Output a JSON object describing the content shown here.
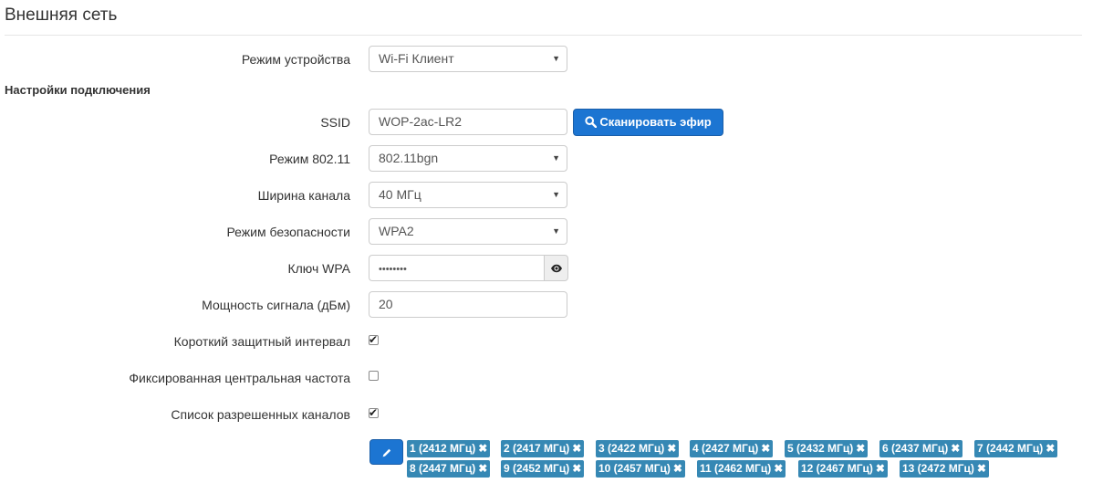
{
  "page": {
    "title": "Внешняя сеть",
    "section_title": "Настройки подключения"
  },
  "fields": {
    "device_mode": {
      "label": "Режим устройства",
      "value": "Wi-Fi Клиент"
    },
    "ssid": {
      "label": "SSID",
      "value": "WOP-2ac-LR2"
    },
    "scan_button": "Сканировать эфир",
    "mode_80211": {
      "label": "Режим 802.11",
      "value": "802.11bgn"
    },
    "channel_width": {
      "label": "Ширина канала",
      "value": "40 МГц"
    },
    "security_mode": {
      "label": "Режим безопасности",
      "value": "WPA2"
    },
    "wpa_key": {
      "label": "Ключ WPA",
      "value": "••••••••"
    },
    "signal_power": {
      "label": "Мощность сигнала (дБм)",
      "value": "20"
    },
    "short_guard_interval": {
      "label": "Короткий защитный интервал",
      "checked": true
    },
    "fixed_center_freq": {
      "label": "Фиксированная центральная частота",
      "checked": false
    },
    "allowed_channels": {
      "label": "Список разрешенных каналов",
      "checked": true
    }
  },
  "channel_tags": [
    "1 (2412 МГц)",
    "2 (2417 МГц)",
    "3 (2422 МГц)",
    "4 (2427 МГц)",
    "5 (2432 МГц)",
    "6 (2437 МГц)",
    "7 (2442 МГц)",
    "8 (2447 МГц)",
    "9 (2452 МГц)",
    "10 (2457 МГц)",
    "11 (2462 МГц)",
    "12 (2467 МГц)",
    "13 (2472 МГц)"
  ],
  "icons": {
    "search": "search-icon",
    "eye": "eye-icon",
    "pencil": "pencil-icon",
    "remove": "remove-icon"
  },
  "colors": {
    "primary_button": "#1c75d2",
    "tag_background": "#3688b4"
  }
}
